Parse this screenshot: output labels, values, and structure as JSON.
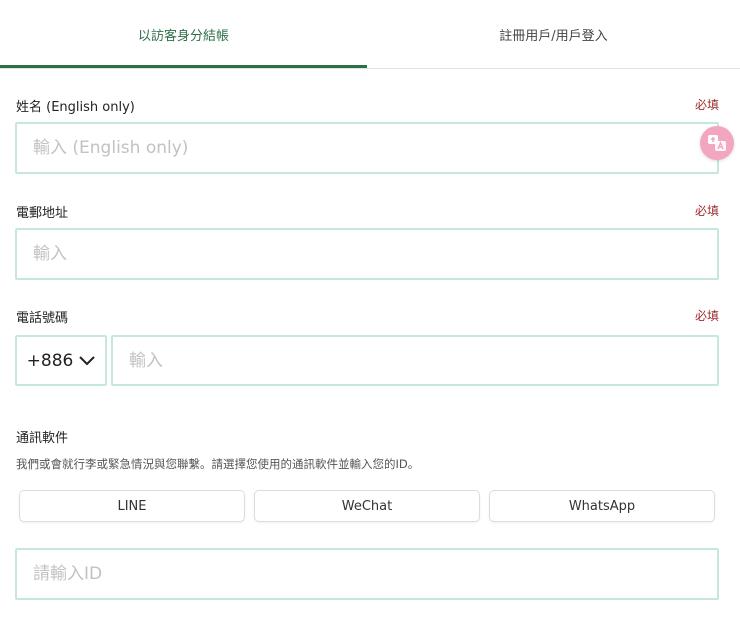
{
  "tabs": {
    "guest": "以訪客身分結帳",
    "login": "註冊用戶/用戶登入"
  },
  "form": {
    "name": {
      "label": "姓名 (English only)",
      "required": "必填",
      "placeholder": "輸入 (English only)"
    },
    "email": {
      "label": "電郵地址",
      "required": "必填",
      "placeholder": "輸入"
    },
    "phone": {
      "label": "電話號碼",
      "required": "必填",
      "country_code": "+886",
      "placeholder": "輸入"
    },
    "messaging": {
      "label": "通訊軟件",
      "hint": "我們或會就行李或緊急情況與您聯繫。請選擇您使用的通訊軟件並輸入您的ID。",
      "apps": [
        "LINE",
        "WeChat",
        "WhatsApp"
      ],
      "id_placeholder": "請輸入ID"
    }
  },
  "colors": {
    "accent": "#2e6f48",
    "required": "#9b2d2d",
    "input_border": "#c6e8d9",
    "translate_badge": "#f3a6c0"
  },
  "icons": {
    "country_dropdown": "chevron-down-icon",
    "translate": "translate-icon"
  }
}
